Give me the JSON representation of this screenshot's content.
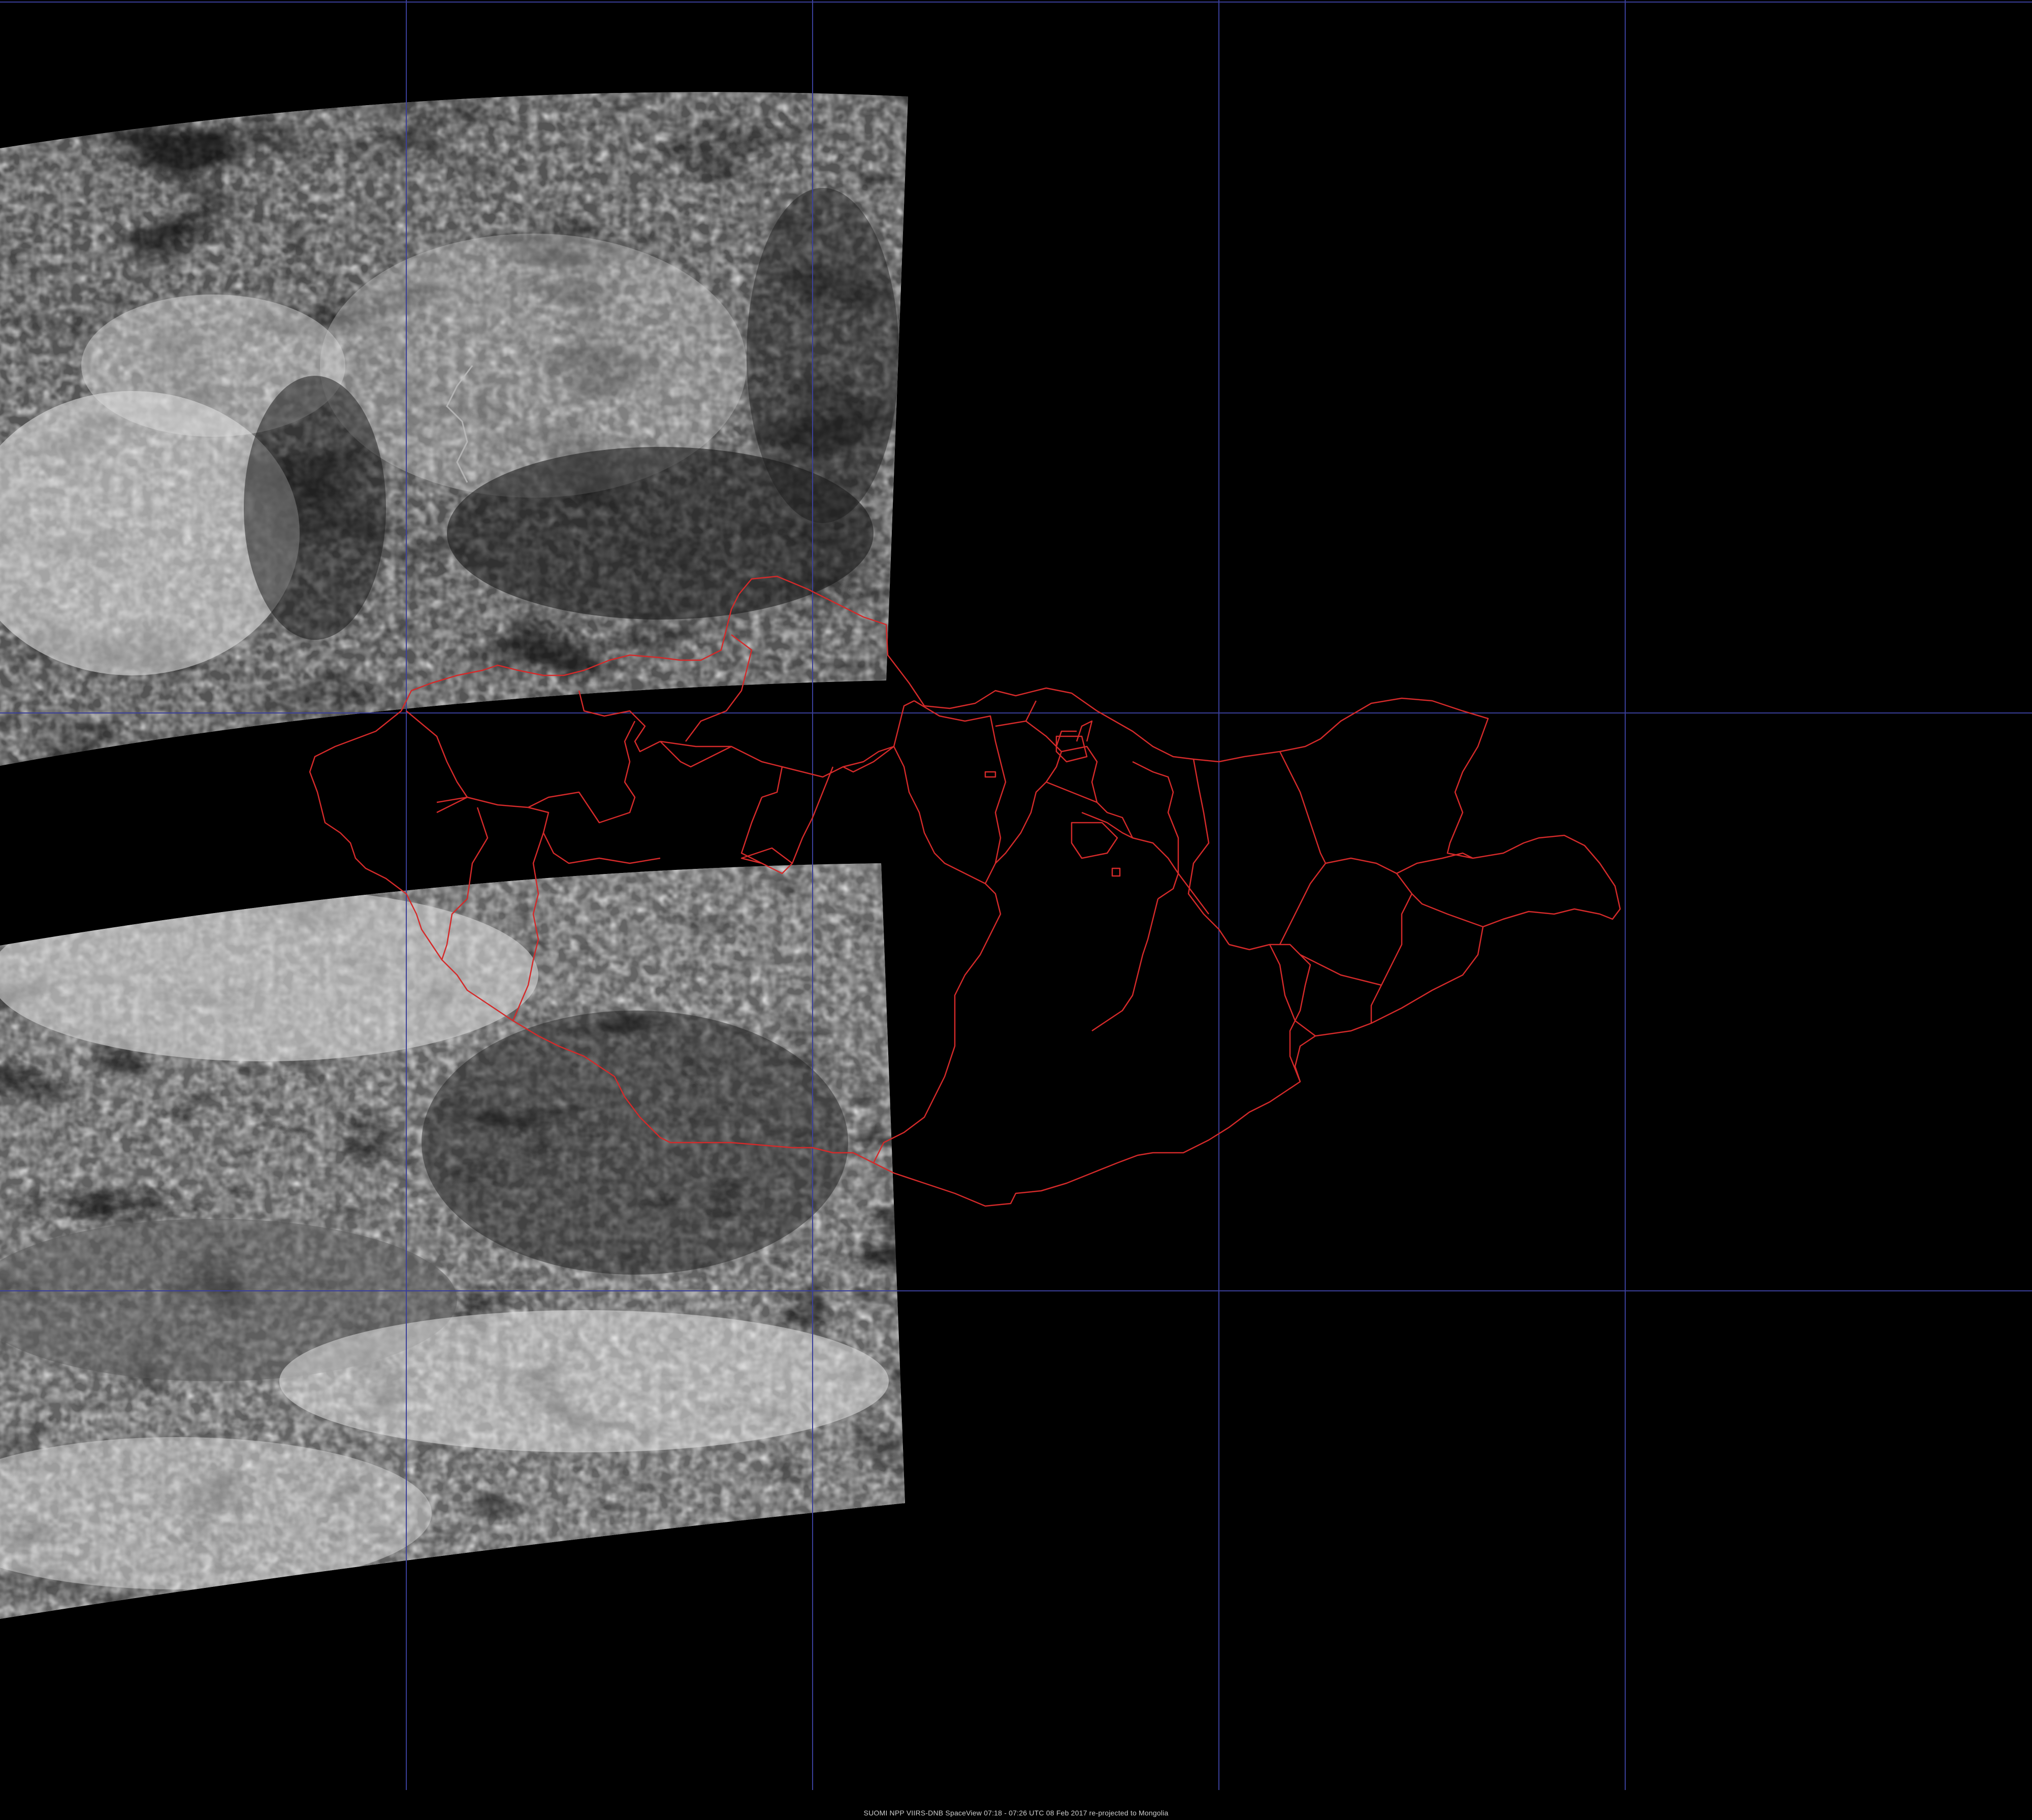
{
  "caption": "SUOMI NPP VIIRS-DNB SpaceView 07:18 - 07:26 UTC 08 Feb 2017 re-projected to Mongolia",
  "colors": {
    "background": "#000000",
    "graticule": "#3a3f9a",
    "boundary": "#d42a2a",
    "imagery_light": "#d9d9d9",
    "imagery_dark": "#2b2b2b"
  },
  "layers": {
    "graticule": "latitude-longitude grid",
    "boundaries": "Mongolia aimag boundaries",
    "imagery": "VIIRS day/night band swaths"
  }
}
